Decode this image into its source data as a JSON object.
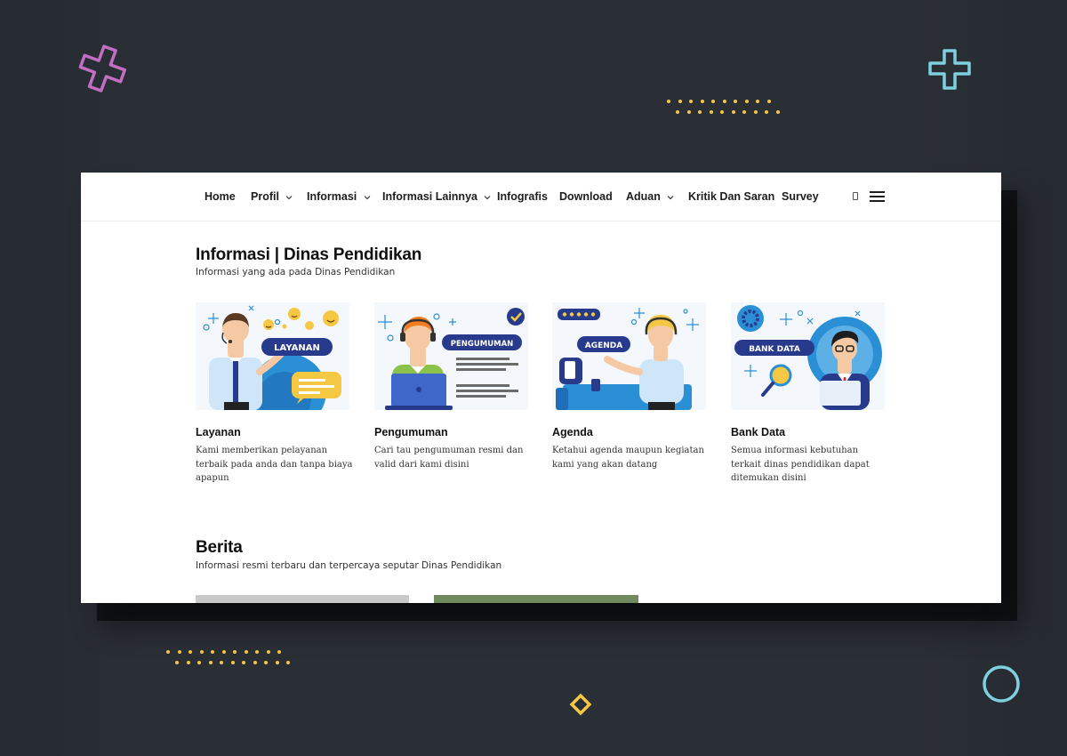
{
  "nav": {
    "items": [
      {
        "label": "Home",
        "has_dropdown": false
      },
      {
        "label": "Profil",
        "has_dropdown": true
      },
      {
        "label": "Informasi",
        "has_dropdown": true
      },
      {
        "label": "Informasi Lainnya",
        "has_dropdown": true
      },
      {
        "label": "Infografis",
        "has_dropdown": false
      },
      {
        "label": "Download",
        "has_dropdown": false
      },
      {
        "label": "Aduan",
        "has_dropdown": true
      },
      {
        "label": "Kritik Dan Saran",
        "has_dropdown": false
      },
      {
        "label": "Survey",
        "has_dropdown": false
      }
    ],
    "menu_icon": "hamburger-icon"
  },
  "info_section": {
    "title": "Informasi | Dinas Pendidikan",
    "subtitle": "Informasi yang ada pada Dinas Pendidikan",
    "cards": [
      {
        "title": "Layanan",
        "badge": "LAYANAN",
        "description": "Kami memberikan pelayanan terbaik pada anda dan tanpa biaya apapun"
      },
      {
        "title": "Pengumuman",
        "badge": "PENGUMUMAN",
        "description": "Cari tau pengumuman resmi dan valid dari kami disini"
      },
      {
        "title": "Agenda",
        "badge": "AGENDA",
        "description": "Ketahui agenda maupun kegiatan kami yang akan datang"
      },
      {
        "title": "Bank Data",
        "badge": "BANK DATA",
        "description": "Semua informasi kebutuhan terkait dinas pendidikan dapat ditemukan disini"
      }
    ]
  },
  "news_section": {
    "title": "Berita",
    "subtitle": "Informasi resmi terbaru dan terpercaya seputar Dinas Pendidikan"
  },
  "colors": {
    "background": "#2a2e35",
    "accent_navy": "#283a8c",
    "accent_blue": "#2b8fd6",
    "dot_yellow": "#f5c843",
    "deco_pink": "#c16ec3",
    "deco_cyan": "#7fd0de"
  }
}
